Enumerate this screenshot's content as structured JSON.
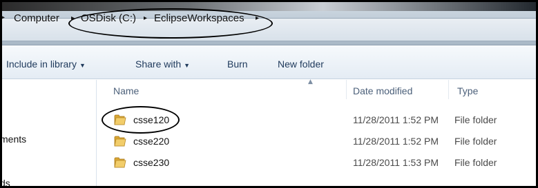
{
  "breadcrumb": {
    "items": [
      "Computer",
      "OSDisk (C:)",
      "EclipseWorkspaces"
    ]
  },
  "toolbar": {
    "include_label": "Include in library",
    "share_label": "Share with",
    "burn_label": "Burn",
    "newfolder_label": "New folder"
  },
  "nav": {
    "items": [
      "ments",
      "ds"
    ]
  },
  "columns": {
    "name": "Name",
    "date": "Date modified",
    "type": "Type"
  },
  "files": [
    {
      "name": "csse120",
      "date": "11/28/2011 1:52 PM",
      "type": "File folder"
    },
    {
      "name": "csse220",
      "date": "11/28/2011 1:52 PM",
      "type": "File folder"
    },
    {
      "name": "csse230",
      "date": "11/28/2011 1:53 PM",
      "type": "File folder"
    }
  ],
  "colors": {
    "toolbar_text": "#1e395b",
    "folder": "#e8b84a",
    "annotation": "#000000"
  }
}
